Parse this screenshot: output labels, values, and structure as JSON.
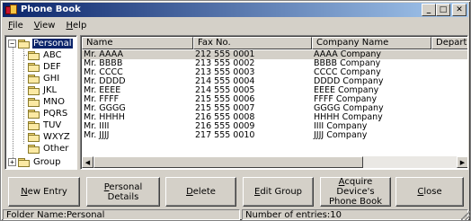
{
  "window": {
    "title": "Phone Book"
  },
  "title_buttons": {
    "minimize": "_",
    "maximize": "□",
    "close": "✕"
  },
  "menu": [
    {
      "label_u": "F",
      "label_rest": "ile"
    },
    {
      "label_u": "V",
      "label_rest": "iew"
    },
    {
      "label_u": "H",
      "label_rest": "elp"
    }
  ],
  "tree": {
    "root": {
      "label": "Personal",
      "expander": "−"
    },
    "children": [
      "ABC",
      "DEF",
      "GHI",
      "JKL",
      "MNO",
      "PQRS",
      "TUV",
      "WXYZ",
      "Other"
    ],
    "group": {
      "label": "Group",
      "expander": "+"
    }
  },
  "list": {
    "columns": [
      "Name",
      "Fax No.",
      "Company Name",
      "Departme"
    ],
    "rows": [
      [
        "Mr. AAAA",
        "212 555 0001",
        "AAAA Company",
        ""
      ],
      [
        "Mr. BBBB",
        "213 555 0002",
        "BBBB Company",
        ""
      ],
      [
        "Mr. CCCC",
        "213 555 0003",
        "CCCC Company",
        ""
      ],
      [
        "Mr. DDDD",
        "214 555 0004",
        "DDDD Company",
        ""
      ],
      [
        "Mr. EEEE",
        "214 555 0005",
        "EEEE Company",
        ""
      ],
      [
        "Mr. FFFF",
        "215 555 0006",
        "FFFF Company",
        ""
      ],
      [
        "Mr. GGGG",
        "215 555 0007",
        "GGGG Company",
        ""
      ],
      [
        "Mr. HHHH",
        "216 555 0008",
        "HHHH Company",
        ""
      ],
      [
        "Mr. IIII",
        "216 555 0009",
        "IIII Company",
        ""
      ],
      [
        "Mr. JJJJ",
        "217 555 0010",
        "JJJJ Company",
        ""
      ]
    ],
    "scroll_left": "◀",
    "scroll_right": "▶"
  },
  "buttons": {
    "new_entry": {
      "u": "N",
      "rest": "ew Entry"
    },
    "personal_details": {
      "u": "P",
      "rest": "ersonal Details"
    },
    "delete": {
      "u": "D",
      "rest": "elete"
    },
    "edit_group": {
      "u": "E",
      "rest": "dit Group"
    },
    "acquire": {
      "line1_u": "A",
      "line1_rest": "cquire Device's",
      "line2": "Phone Book"
    },
    "close": {
      "u": "C",
      "rest": "lose"
    }
  },
  "status": {
    "folder": "Folder Name:Personal",
    "entries_prefix": "Number of entries:",
    "entries_count": "10"
  }
}
